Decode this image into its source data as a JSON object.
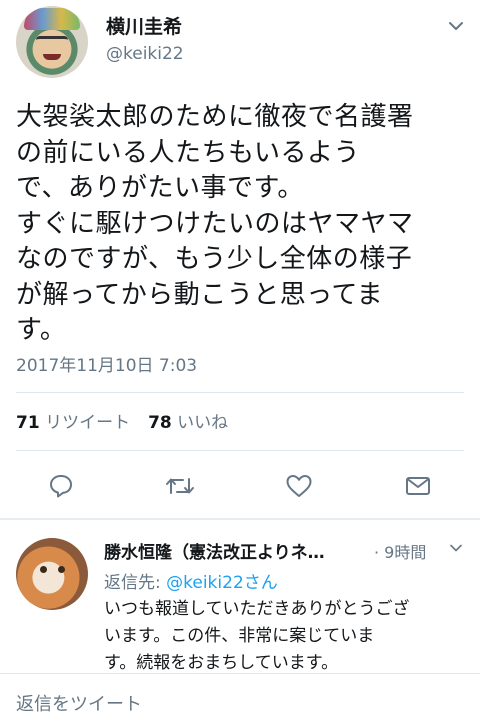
{
  "tweet": {
    "display_name": "横川圭希",
    "handle": "@keiki22",
    "text": "大袈裟太郎のために徹夜で名護署\nの前にいる人たちもいるよう\nで、ありがたい事です。\nすぐに駆けつけたいのはヤマヤマ\nなのですが、もう少し全体の様子\nが解ってから動こうと思ってま\nす。",
    "timestamp": "2017年11月10日 7:03",
    "retweets_count": "71",
    "retweets_label": "リツイート",
    "likes_count": "78",
    "likes_label": "いいね"
  },
  "actions": {
    "icons": [
      "reply-icon",
      "retweet-icon",
      "like-icon",
      "direct-message-icon"
    ],
    "color": "#657786"
  },
  "reply": {
    "display_name": "勝水恒隆（憲法改正よりネ…",
    "time": "· 9時間",
    "reply_to_prefix": "返信先: ",
    "reply_to_handle": "@keiki22さん",
    "text": "いつも報道していただきありがとうござ\nいます。この件、非常に案じていま\nす。続報をおまちしています。"
  },
  "compose": {
    "placeholder": "返信をツイート"
  },
  "colors": {
    "link": "#1da1f2",
    "secondary_text": "#657786",
    "primary_text": "#14171a",
    "divider": "#e1e8ed"
  }
}
